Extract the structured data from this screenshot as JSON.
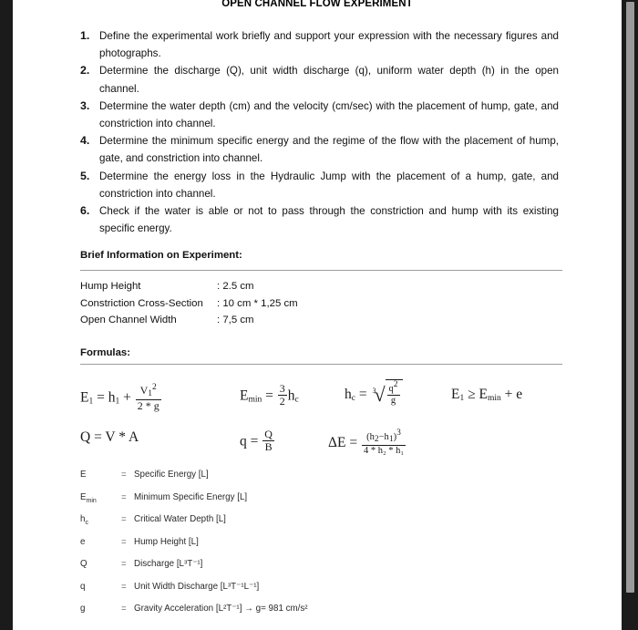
{
  "document": {
    "title": "OPEN CHANNEL FLOW EXPERIMENT",
    "tasks": [
      {
        "num": "1.",
        "text": "Define the experimental work briefly and support your expression with the necessary figures and photographs."
      },
      {
        "num": "2.",
        "text": "Determine the discharge (Q), unit width discharge (q), uniform water depth (h) in the open channel."
      },
      {
        "num": "3.",
        "text": "Determine the water depth (cm) and the velocity (cm/sec) with the placement of hump, gate, and constriction into channel."
      },
      {
        "num": "4.",
        "text": "Determine the minimum specific energy and the regime of the flow with the placement of hump, gate, and constriction into channel."
      },
      {
        "num": "5.",
        "text": "Determine the energy loss in the Hydraulic Jump with the placement of a hump, gate, and constriction into channel."
      },
      {
        "num": "6.",
        "text": "Check if the water is able or not to pass through the constriction and hump with its existing specific energy."
      }
    ],
    "brief_info": {
      "heading": "Brief Information on Experiment:",
      "rows": [
        {
          "label": "Hump Height",
          "value": ": 2.5 cm"
        },
        {
          "label": "Constriction Cross-Section",
          "value": ": 10 cm * 1,25 cm"
        },
        {
          "label": "Open Channel Width",
          "value": ": 7,5 cm"
        }
      ]
    },
    "formulas": {
      "heading": "Formulas:",
      "row1": {
        "f1": {
          "lhs_sym": "E",
          "lhs_sub": "1",
          "eq": "=",
          "term1_sym": "h",
          "term1_sub": "1",
          "plus": "+",
          "frac_num_sym": "V",
          "frac_num_sub": "1",
          "frac_num_sup": "2",
          "frac_den": "2 * g"
        },
        "f2": {
          "lhs_sym": "E",
          "lhs_sub": "min",
          "eq": "=",
          "frac_num": "3",
          "frac_den": "2",
          "rhs_sym": "h",
          "rhs_sub": "c"
        },
        "f3": {
          "lhs_sym": "h",
          "lhs_sub": "c",
          "eq": "=",
          "root_index": "3",
          "rad_num_sym": "q",
          "rad_num_sup": "2",
          "rad_den": "g"
        },
        "f4": {
          "lhs_sym": "E",
          "lhs_sub": "1",
          "rel": "≥",
          "rhs_sym": "E",
          "rhs_sub": "min",
          "plus": "+",
          "tail": "e"
        }
      },
      "row2": {
        "f5": {
          "text": "Q = V * A"
        },
        "f6": {
          "lhs": "q",
          "eq": "=",
          "frac_num": "Q",
          "frac_den": "B"
        },
        "f7": {
          "lhs": "ΔE",
          "eq": "=",
          "num_open": "(h",
          "num_sub1": "2",
          "num_minus": "−h",
          "num_sub2": "1",
          "num_close": ")",
          "num_sup": "3",
          "den": "4 * h₂ * h₁"
        }
      }
    },
    "definitions": [
      {
        "symbol": "E",
        "sym_sub": "",
        "eq": "=",
        "text": "Specific Energy [L]"
      },
      {
        "symbol": "E",
        "sym_sub": "min",
        "eq": "=",
        "text": "Minimum Specific Energy [L]"
      },
      {
        "symbol": "h",
        "sym_sub": "c",
        "eq": "=",
        "text": "Critical Water Depth [L]"
      },
      {
        "symbol": "e",
        "sym_sub": "",
        "eq": "=",
        "text": "Hump Height [L]"
      },
      {
        "symbol": "Q",
        "sym_sub": "",
        "eq": "=",
        "text": "Discharge [L³T⁻¹]"
      },
      {
        "symbol": "q",
        "sym_sub": "",
        "eq": "=",
        "text": "Unit Width Discharge [L³T⁻¹L⁻¹]"
      },
      {
        "symbol": "g",
        "sym_sub": "",
        "eq": "=",
        "text": "Gravity Acceleration [L²T⁻¹] → g= 981 cm/s²"
      }
    ]
  },
  "viewer": {
    "background_color": "#1b1b1b",
    "page_color": "#ffffff",
    "scrollbar_color": "#9a9a9a"
  }
}
